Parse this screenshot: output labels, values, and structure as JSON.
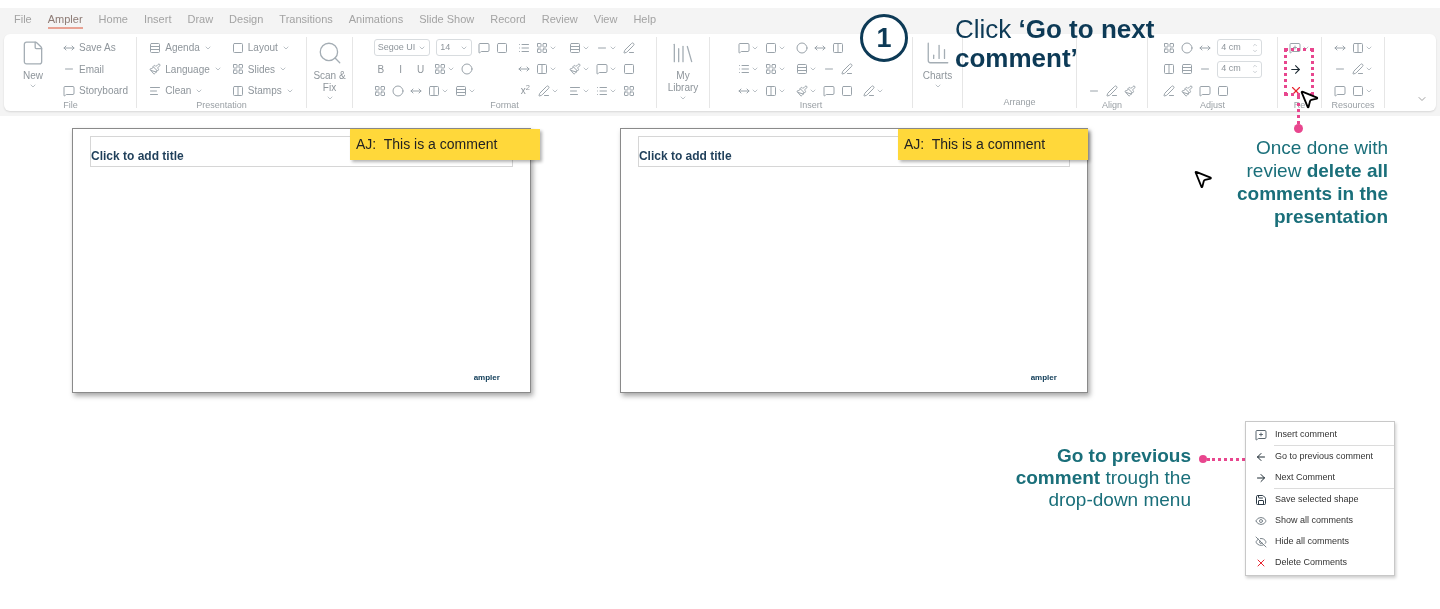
{
  "tabs": [
    {
      "label": "File",
      "selected": false
    },
    {
      "label": "Ampler",
      "selected": true
    },
    {
      "label": "Home",
      "selected": false
    },
    {
      "label": "Insert",
      "selected": false
    },
    {
      "label": "Draw",
      "selected": false
    },
    {
      "label": "Design",
      "selected": false
    },
    {
      "label": "Transitions",
      "selected": false
    },
    {
      "label": "Animations",
      "selected": false
    },
    {
      "label": "Slide Show",
      "selected": false
    },
    {
      "label": "Record",
      "selected": false
    },
    {
      "label": "Review",
      "selected": false
    },
    {
      "label": "View",
      "selected": false
    },
    {
      "label": "Help",
      "selected": false
    }
  ],
  "ribbon": {
    "groups": [
      {
        "label": "File",
        "columns": [
          {
            "kind": "large",
            "label": "New",
            "dropdown": true
          },
          {
            "kind": "stack",
            "lines": [
              [
                {
                  "kind": "small",
                  "label": "Save As"
                }
              ],
              [
                {
                  "kind": "small",
                  "label": "Email"
                }
              ],
              [
                {
                  "kind": "small",
                  "label": "Storyboard"
                }
              ]
            ]
          }
        ]
      },
      {
        "label": "Presentation",
        "columns": [
          {
            "kind": "stack",
            "lines": [
              [
                {
                  "kind": "small",
                  "label": "Agenda",
                  "dropdown": true
                }
              ],
              [
                {
                  "kind": "small",
                  "label": "Language",
                  "dropdown": true
                }
              ],
              [
                {
                  "kind": "small",
                  "label": "Clean",
                  "dropdown": true
                }
              ]
            ]
          },
          {
            "kind": "stack",
            "lines": [
              [
                {
                  "kind": "small",
                  "label": "Layout",
                  "dropdown": true
                }
              ],
              [
                {
                  "kind": "small",
                  "label": "Slides",
                  "dropdown": true
                }
              ],
              [
                {
                  "kind": "small",
                  "label": "Stamps",
                  "dropdown": true
                }
              ]
            ]
          }
        ]
      },
      {
        "columns": [
          {
            "kind": "large",
            "label": "Scan & Fix",
            "dropdown": true
          }
        ]
      },
      {
        "label": "Format",
        "columns": [
          {
            "kind": "stack",
            "lines": [
              [
                {
                  "kind": "field",
                  "value": "Segoe UI",
                  "dropdown": true
                },
                {
                  "kind": "field",
                  "value": "14",
                  "dropdown": true
                },
                {
                  "kind": "icon"
                },
                {
                  "kind": "icon"
                }
              ],
              [
                {
                  "kind": "glyph",
                  "text": "B"
                },
                {
                  "kind": "glyph",
                  "text": "I"
                },
                {
                  "kind": "glyph",
                  "text": "U"
                },
                {
                  "kind": "icon",
                  "dropdown": true
                },
                {
                  "kind": "icon"
                }
              ],
              [
                {
                  "kind": "icon"
                },
                {
                  "kind": "icon"
                },
                {
                  "kind": "icon"
                },
                {
                  "kind": "icon",
                  "dropdown": true
                },
                {
                  "kind": "icon",
                  "dropdown": true
                }
              ]
            ]
          },
          {
            "kind": "stack",
            "lines": [
              [
                {
                  "kind": "icon"
                },
                {
                  "kind": "icon",
                  "dropdown": true
                }
              ],
              [
                {
                  "kind": "icon"
                },
                {
                  "kind": "icon",
                  "dropdown": true
                }
              ],
              [
                {
                  "kind": "glyph",
                  "text": "x$^{2}$"
                },
                {
                  "kind": "icon",
                  "dropdown": true
                }
              ]
            ]
          },
          {
            "kind": "stack",
            "lines": [
              [
                {
                  "kind": "icon",
                  "dropdown": true
                },
                {
                  "kind": "icon",
                  "dropdown": true
                },
                {
                  "kind": "icon"
                }
              ],
              [
                {
                  "kind": "icon",
                  "dropdown": true
                },
                {
                  "kind": "icon",
                  "dropdown": true
                },
                {
                  "kind": "icon"
                }
              ],
              [
                {
                  "kind": "icon",
                  "dropdown": true
                },
                {
                  "kind": "icon",
                  "dropdown": true
                },
                {
                  "kind": "icon"
                }
              ]
            ]
          }
        ]
      },
      {
        "columns": [
          {
            "kind": "large",
            "label": "My Library",
            "dropdown": true
          }
        ]
      },
      {
        "label": "Insert",
        "columns": [
          {
            "kind": "stack",
            "lines": [
              [
                {
                  "kind": "icon",
                  "dropdown": true
                },
                {
                  "kind": "icon",
                  "dropdown": true
                }
              ],
              [
                {
                  "kind": "icon",
                  "dropdown": true
                },
                {
                  "kind": "icon",
                  "dropdown": true
                }
              ],
              [
                {
                  "kind": "icon",
                  "dropdown": true
                },
                {
                  "kind": "icon",
                  "dropdown": true
                }
              ]
            ]
          },
          {
            "kind": "stack",
            "lines": [
              [
                {
                  "kind": "icon"
                },
                {
                  "kind": "icon"
                },
                {
                  "kind": "icon"
                }
              ],
              [
                {
                  "kind": "icon",
                  "dropdown": true
                },
                {
                  "kind": "icon"
                },
                {
                  "kind": "icon"
                }
              ],
              [
                {
                  "kind": "icon",
                  "dropdown": true
                },
                {
                  "kind": "icon"
                },
                {
                  "kind": "icon"
                }
              ]
            ]
          },
          {
            "kind": "stack",
            "lines": [
              [
                {
                  "kind": "icon",
                  "dropdown": true
                }
              ]
            ]
          }
        ]
      },
      {
        "columns": [
          {
            "kind": "large",
            "label": "Charts",
            "dropdown": true
          }
        ]
      },
      {
        "label": "Arrange"
      },
      {
        "label": "Align",
        "columns": [
          {
            "kind": "stack",
            "lines": [
              [
                {
                  "kind": "icon"
                },
                {
                  "kind": "icon"
                },
                {
                  "kind": "icon"
                }
              ]
            ]
          }
        ]
      },
      {
        "label": "Adjust",
        "columns": [
          {
            "kind": "stack",
            "lines": [
              [
                {
                  "kind": "icon"
                },
                {
                  "kind": "icon"
                },
                {
                  "kind": "icon"
                },
                {
                  "kind": "field",
                  "value": "4 cm",
                  "spinner": true
                }
              ],
              [
                {
                  "kind": "icon"
                },
                {
                  "kind": "icon"
                },
                {
                  "kind": "icon"
                },
                {
                  "kind": "field",
                  "value": "4 cm",
                  "spinner": true
                }
              ],
              [
                {
                  "kind": "icon"
                },
                {
                  "kind": "icon"
                },
                {
                  "kind": "icon"
                },
                {
                  "kind": "icon"
                }
              ]
            ]
          }
        ]
      },
      {
        "label": "Re",
        "columns": [
          {
            "kind": "stack",
            "lines": [
              [
                {
                  "kind": "comment",
                  "dropdown": true
                }
              ],
              [
                {
                  "kind": "next"
                }
              ],
              [
                {
                  "kind": "delete"
                }
              ]
            ]
          }
        ]
      },
      {
        "label": "Resources",
        "columns": [
          {
            "kind": "stack",
            "lines": [
              [
                {
                  "kind": "icon"
                },
                {
                  "kind": "icon",
                  "dropdown": true
                }
              ],
              [
                {
                  "kind": "icon"
                },
                {
                  "kind": "icon",
                  "dropdown": true
                }
              ],
              [
                {
                  "kind": "icon"
                },
                {
                  "kind": "icon",
                  "dropdown": true
                }
              ]
            ]
          }
        ]
      }
    ]
  },
  "step": {
    "number": "1",
    "lines": [
      "Click **‘Go to next**",
      "**comment’**"
    ]
  },
  "slides": [
    {
      "title": "Click to add title",
      "comment": "AJ:  This is a comment",
      "logo": "ampler"
    },
    {
      "title": "Click to add title",
      "comment": "AJ:  This is a comment",
      "logo": "ampler"
    }
  ],
  "note_delete": "Once done with review **delete all comments in the presentation**",
  "note_previous": "**Go to previous comment** trough the drop-down menu",
  "menu": {
    "sections": [
      [
        {
          "kind": "insert",
          "label": "Insert comment"
        }
      ],
      [
        {
          "kind": "previous",
          "label": "Go to previous comment"
        },
        {
          "kind": "next",
          "label": "Next Comment"
        }
      ],
      [
        {
          "kind": "save",
          "label": "Save selected shape"
        },
        {
          "kind": "show",
          "label": "Show all comments"
        },
        {
          "kind": "hide",
          "label": "Hide all comments"
        },
        {
          "kind": "delete",
          "label": "Delete Comments"
        }
      ]
    ]
  }
}
